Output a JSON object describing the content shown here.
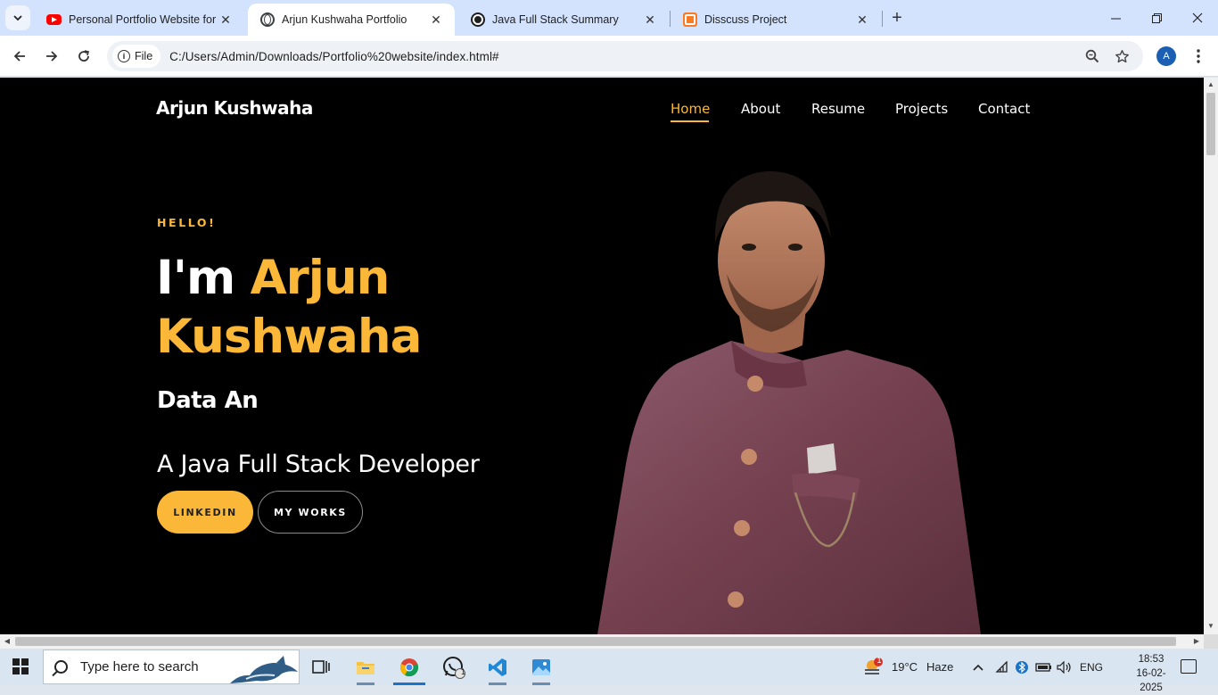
{
  "browser": {
    "tabs": [
      {
        "title": "Personal Portfolio Website for B",
        "favicon": "youtube-icon",
        "active": false
      },
      {
        "title": "Arjun Kushwaha Portfolio",
        "favicon": "globe-icon",
        "active": true
      },
      {
        "title": "Java Full Stack Summary",
        "favicon": "chatgpt-icon",
        "active": false
      },
      {
        "title": "Disscuss Project",
        "favicon": "xampp-icon",
        "active": false
      }
    ],
    "omnibox": {
      "chip_label": "File",
      "url": "C:/Users/Admin/Downloads/Portfolio%20website/index.html#"
    },
    "profile_initial": "A"
  },
  "page": {
    "brand": "Arjun Kushwaha",
    "nav": [
      {
        "label": "Home",
        "active": true
      },
      {
        "label": "About",
        "active": false
      },
      {
        "label": "Resume",
        "active": false
      },
      {
        "label": "Projects",
        "active": false
      },
      {
        "label": "Contact",
        "active": false
      }
    ],
    "hero": {
      "greeting": "HELLO!",
      "title_prefix": "I'm ",
      "name_first": "Arjun",
      "name_last": "Kushwaha",
      "typed_text": "Data An",
      "tagline": "A Java Full Stack Developer",
      "buttons": {
        "primary": "LINKEDIN",
        "secondary": "MY WORKS"
      }
    },
    "colors": {
      "accent": "#fbb838",
      "background": "#000000"
    }
  },
  "taskbar": {
    "search_placeholder": "Type here to search",
    "apps": [
      "task-view-icon",
      "file-explorer-icon",
      "chrome-icon",
      "whatsapp-icon",
      "vscode-icon",
      "photos-icon"
    ],
    "whatsapp_badge": "1",
    "weather": {
      "badge": "1",
      "temperature": "19°C",
      "condition": "Haze"
    },
    "language": "ENG",
    "time": "18:53",
    "date": "16-02-2025"
  }
}
